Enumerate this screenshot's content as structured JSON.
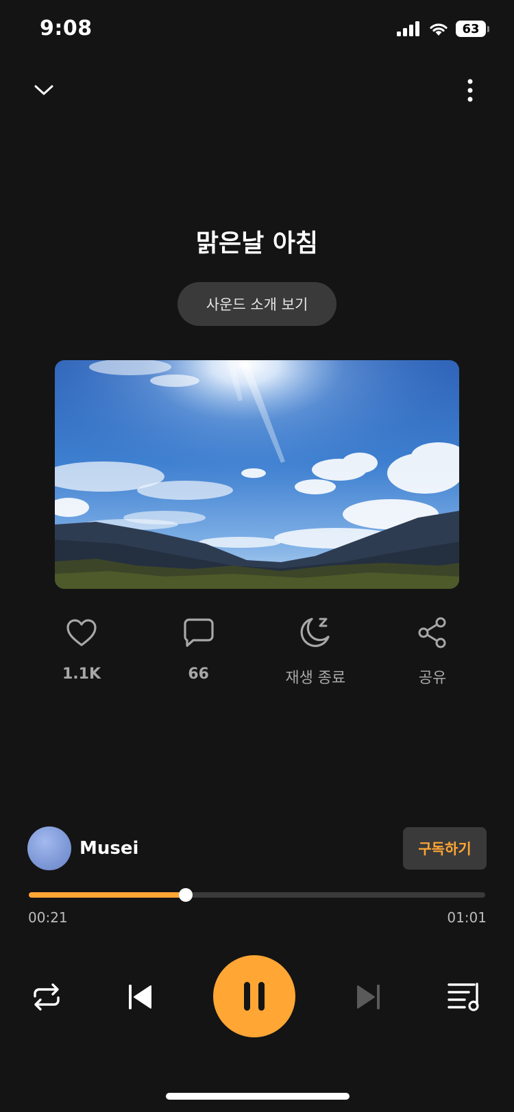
{
  "status_bar": {
    "time": "9:08",
    "battery": "63"
  },
  "header": {
    "collapse_icon": "chevron-down-icon",
    "more_icon": "more-vertical-icon"
  },
  "track": {
    "title": "맑은날 아침",
    "intro_button": "사운드 소개 보기"
  },
  "actions": [
    {
      "icon": "heart-icon",
      "label": "1.1K"
    },
    {
      "icon": "comment-icon",
      "label": "66"
    },
    {
      "icon": "sleep-timer-icon",
      "label": "재생 종료"
    },
    {
      "icon": "share-icon",
      "label": "공유"
    }
  ],
  "creator": {
    "name": "Musei",
    "subscribe_label": "구독하기"
  },
  "player": {
    "current_time": "00:21",
    "total_time": "01:01",
    "progress": 0.344,
    "state": "playing"
  },
  "colors": {
    "accent": "#ffa634",
    "background": "#141414",
    "chip": "#3a3a3a"
  }
}
